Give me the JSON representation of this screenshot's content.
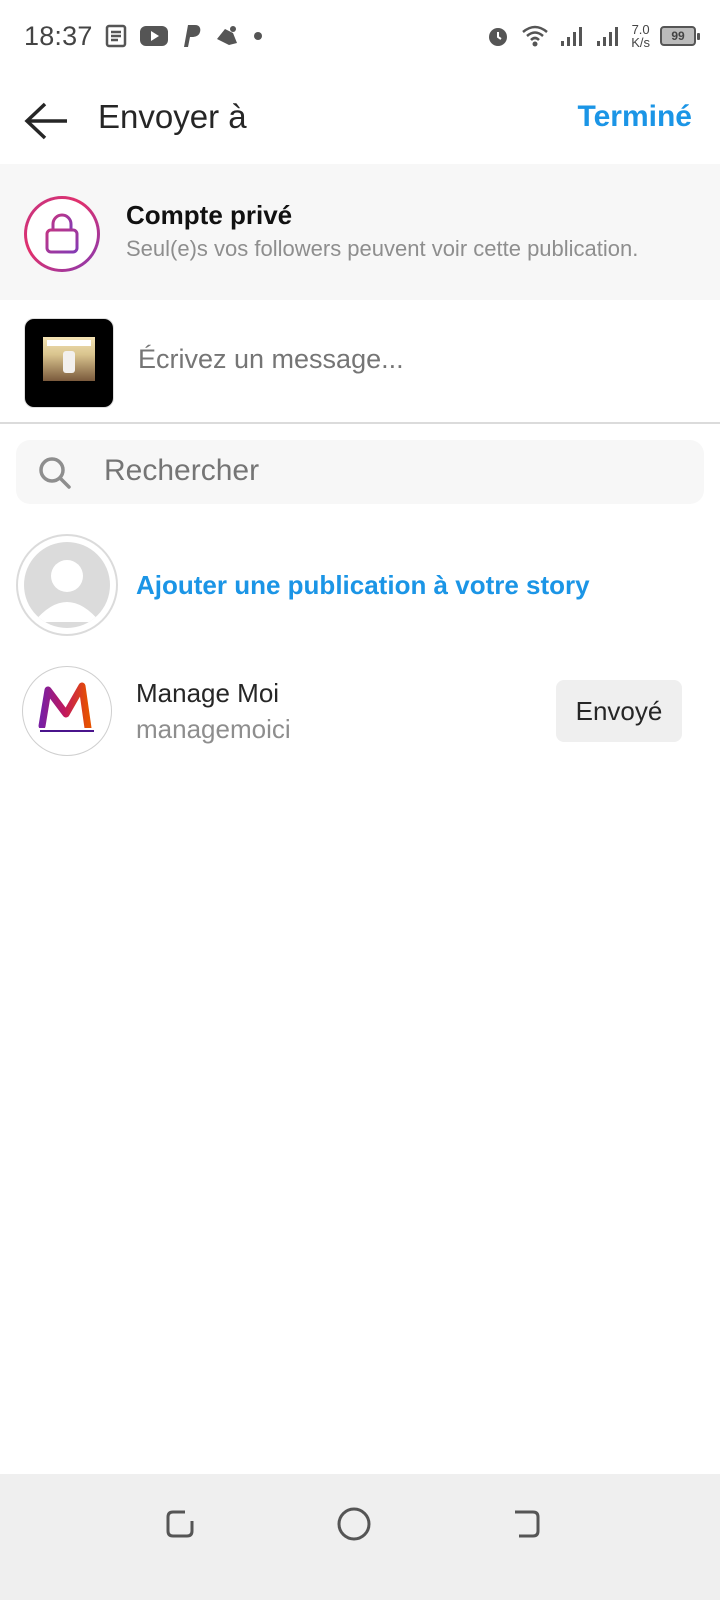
{
  "status_bar": {
    "time": "18:37",
    "net_speed_value": "7.0",
    "net_speed_unit": "K/s",
    "battery_level": "99",
    "left_icons": [
      "news-icon",
      "youtube-icon",
      "paypal-icon",
      "game-controller-icon",
      "dot-icon"
    ],
    "right_icons": [
      "alarm-icon",
      "wifi-icon",
      "signal-icon",
      "signal-icon"
    ]
  },
  "header": {
    "title": "Envoyer à",
    "done_label": "Terminé"
  },
  "private_banner": {
    "title": "Compte privé",
    "description": "Seul(e)s vos followers peuvent voir cette publication."
  },
  "composer": {
    "placeholder": "Écrivez un message..."
  },
  "search": {
    "placeholder": "Rechercher"
  },
  "story": {
    "label": "Ajouter une publication à votre story"
  },
  "contacts": [
    {
      "name": "Manage Moi",
      "username": "managemoici",
      "action_label": "Envoyé"
    }
  ],
  "colors": {
    "accent": "#1b95e6",
    "text": "#262626",
    "muted": "#8e8e8e",
    "banner_bg": "#f7f7f7",
    "nav_bg": "#efefef"
  }
}
